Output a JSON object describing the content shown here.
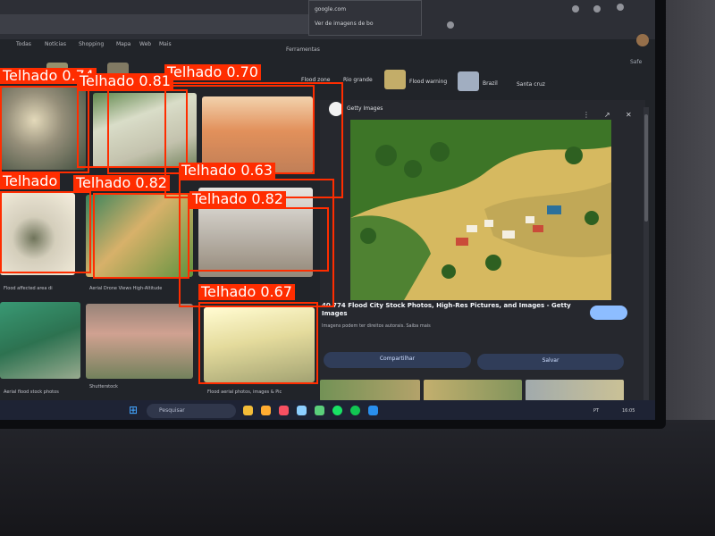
{
  "browser": {
    "dropdown_line_1": "google.com",
    "dropdown_line_2": "Ver de imagens de bo"
  },
  "search_tabs": [
    "Todas",
    "Notícias",
    "Shopping",
    "Mapa",
    "Web",
    "Mais"
  ],
  "tools_label": "Ferramentas",
  "filters_link": "Safe",
  "chips": [
    "Flood zone",
    "Rio grande",
    "Flood warning",
    "Brazil",
    "Santa cruz"
  ],
  "captions": [
    "Flood affected area di",
    "Aerial Drone Views High-Altitude",
    "Shutterstock",
    "Flood aerial photos, images & Pic",
    "Getty Images",
    "Aerial flood stock photos"
  ],
  "preview": {
    "source": "Getty Images",
    "title": "40 774 Flood City Stock Photos, High-Res Pictures, and Images - Getty Images",
    "meta": "Imagens podem ter direitos autorais. Saiba mais",
    "share_label": "Compartilhar",
    "save_label": "Salvar"
  },
  "taskbar": {
    "search_placeholder": "Pesquisar",
    "tray_language": "PT",
    "tray_time": "16:05"
  },
  "detections": [
    {
      "label": "Telhado",
      "score": "0.74"
    },
    {
      "label": "Telhado",
      "score": "0.81"
    },
    {
      "label": "Telhado",
      "score": "0.70"
    },
    {
      "label": "Telhado",
      "score": "0.63"
    },
    {
      "label": "Telhado",
      "score": "0.82"
    },
    {
      "label": "Telhado",
      "score": "0.82"
    },
    {
      "label": "Telhado",
      "score": "0.67"
    },
    {
      "label": "Telhado",
      "score": ""
    }
  ],
  "colors": {
    "detection": "#ff2d00",
    "flood_water": "#c9b063",
    "vegetation": "#3d6e2a"
  }
}
